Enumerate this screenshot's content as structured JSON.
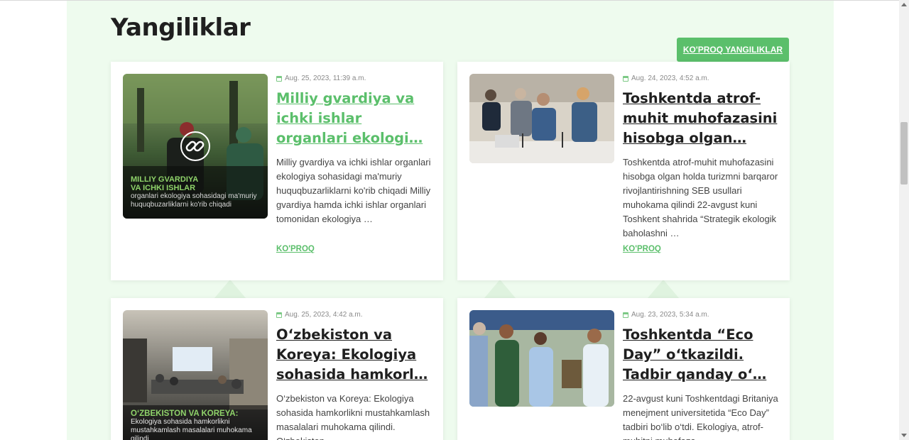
{
  "section": {
    "title": "Yangiliklar",
    "more_news_label": "KO'PROQ YANGILIKLAR"
  },
  "icons": {
    "calendar": "calendar-icon",
    "link": "link-icon"
  },
  "colors": {
    "accent": "#5bbf6b",
    "section_bg": "#eefbee",
    "title": "#1f1f1f"
  },
  "news": [
    {
      "date": "Aug. 25, 2023, 11:39 a.m.",
      "title": "Milliy gvardiya va ichki ishlar organlari ekologi…",
      "excerpt": "Milliy gvardiya va ichki ishlar organlari ekologiya sohasidagi ma'muriy huquqbuzarliklarni ko'rib chiqadi Milliy gvardiya hamda ichki ishlar organlari tomonidan ekologiya …",
      "read_more": "KO'PROQ",
      "image_caption_heading": "MILLIY GVARDIYA VA ICHKI ISHLAR",
      "image_caption_text": "organlari ekologiya sohasidagi ma'muriy huquqbuzarliklarni ko'rib chiqadi"
    },
    {
      "date": "Aug. 24, 2023, 4:52 a.m.",
      "title": "Toshkentda atrof-muhit muhofazasini hisobga olgan…",
      "excerpt": "Toshkentda atrof-muhit muhofazasini hisobga olgan holda turizmni barqaror rivojlantirishning SEB usullari muhokama qilindi 22-avgust kuni Toshkent shahrida “Strategik ekologik baholashni …",
      "read_more": "KO'PROQ"
    },
    {
      "date": "Aug. 25, 2023, 4:42 a.m.",
      "title": "O‘zbekiston va Koreya: Ekologiya sohasida hamkorl…",
      "excerpt": "O‘zbekiston va Koreya: Ekologiya sohasida hamkorlikni mustahkamlash masalalari muhokama qilindi. O‘zbekiston",
      "image_caption_heading": "O‘ZBEKISTON VA KOREYA:",
      "image_caption_text": "Ekologiya sohasida hamkorlikni mustahkamlash masalalari muhokama qilindi"
    },
    {
      "date": "Aug. 23, 2023, 5:34 a.m.",
      "title": "Toshkentda “Eco Day” o‘tkazildi. Tadbir qanday o‘…",
      "excerpt": "22-avgust kuni Toshkentdagi Britaniya menejment universitetida “Eco Day” tadbiri bo‘lib o‘tdi. Ekologiya, atrof-muhitni muhofaza"
    }
  ]
}
